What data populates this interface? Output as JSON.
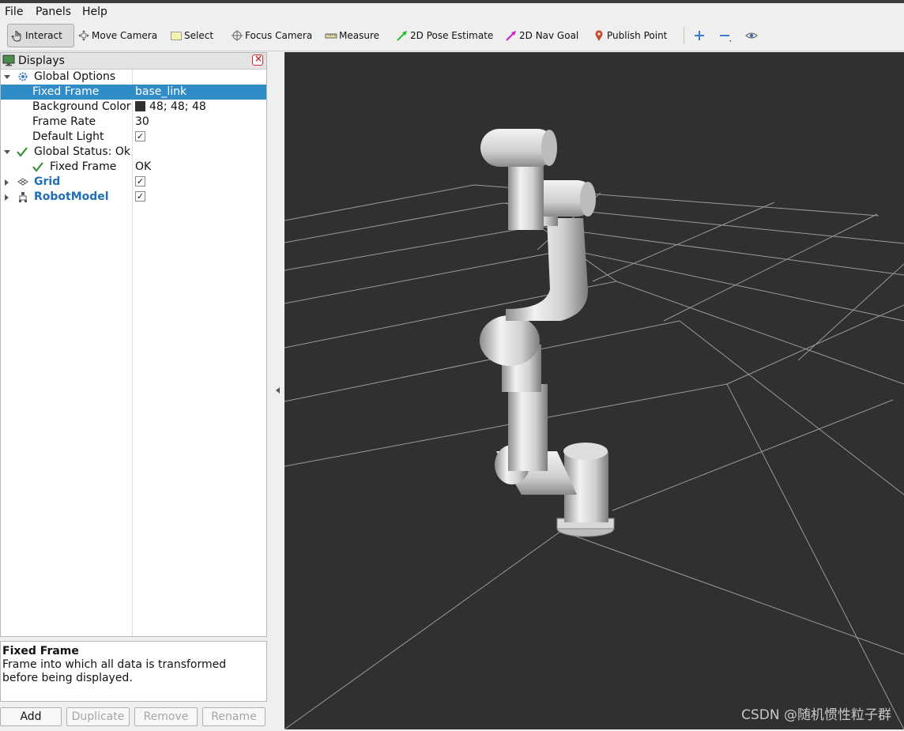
{
  "menu": {
    "file": "File",
    "panels": "Panels",
    "help": "Help"
  },
  "toolbar": {
    "interact": "Interact",
    "move_camera": "Move Camera",
    "select": "Select",
    "focus_camera": "Focus Camera",
    "measure": "Measure",
    "pose_estimate": "2D Pose Estimate",
    "nav_goal": "2D Nav Goal",
    "publish_point": "Publish Point"
  },
  "displays": {
    "title": "Displays",
    "rows": {
      "global_options": "Global Options",
      "fixed_frame_label": "Fixed Frame",
      "fixed_frame_value": "base_link",
      "background_color_label": "Background Color",
      "background_color_value": "48; 48; 48",
      "frame_rate_label": "Frame Rate",
      "frame_rate_value": "30",
      "default_light_label": "Default Light",
      "global_status": "Global Status: Ok",
      "status_fixed_frame_label": "Fixed Frame",
      "status_fixed_frame_value": "OK",
      "grid": "Grid",
      "robot_model": "RobotModel"
    },
    "checks": {
      "default_light": "✓",
      "grid": "✓",
      "robot_model": "✓"
    }
  },
  "description": {
    "title": "Fixed Frame",
    "text": "Frame into which all data is transformed before being displayed."
  },
  "buttons": {
    "add": "Add",
    "duplicate": "Duplicate",
    "remove": "Remove",
    "rename": "Rename"
  },
  "viewport": {
    "watermark": "CSDN @随机惯性粒子群"
  },
  "colors": {
    "viewport_bg": "#303030",
    "selection": "#308cc6",
    "link_blue": "#1e6fb8"
  }
}
